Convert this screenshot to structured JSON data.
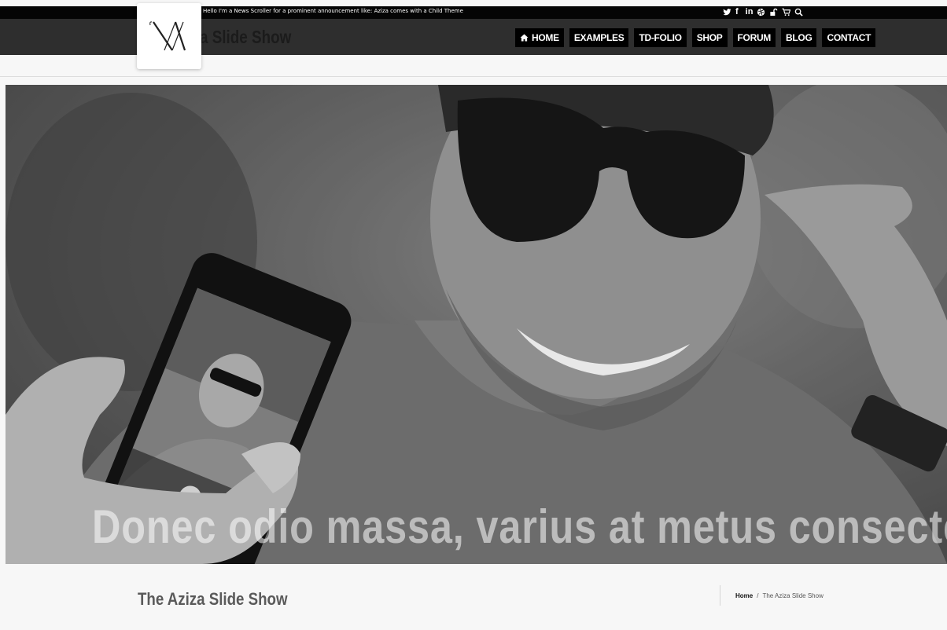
{
  "topbar": {
    "ticker": "Hello I'm a News Scroller for a prominent announcement like: Aziza comes with a Child Theme",
    "social_icons": [
      "twitter-icon",
      "facebook-icon",
      "linkedin-icon",
      "dribbble-icon",
      "lock-icon",
      "cart-icon",
      "search-icon"
    ],
    "social_labels": {
      "facebook": "f",
      "linkedin": "in"
    }
  },
  "header": {
    "site_title": "a Slide Show",
    "nav": [
      "HOME",
      "EXAMPLES",
      "TD-FOLIO",
      "SHOP",
      "FORUM",
      "BLOG",
      "CONTACT"
    ]
  },
  "hero": {
    "caption": "Donec odio massa, varius at metus consectetur,"
  },
  "page": {
    "title": "The Aziza Slide Show",
    "breadcrumb": {
      "home": "Home",
      "separator": "/",
      "current": "The Aziza Slide Show"
    }
  },
  "colors": {
    "topbar": "#050505",
    "header": "#2e2e2e",
    "nav_bg": "#000000",
    "page_bg": "#f7f7f7"
  }
}
